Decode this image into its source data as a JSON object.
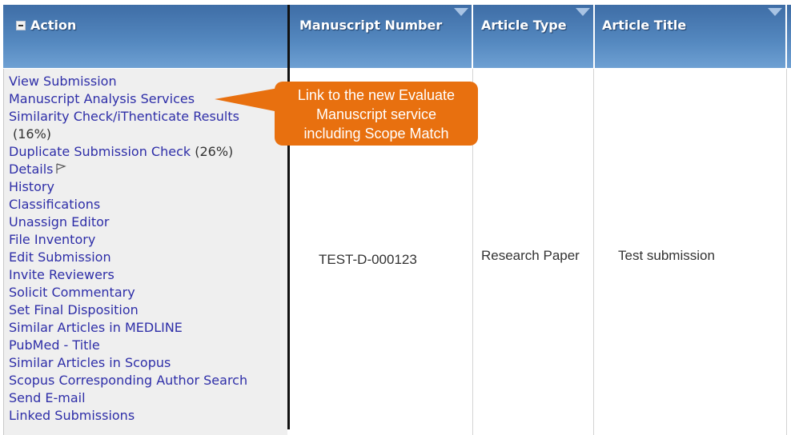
{
  "table": {
    "columns": [
      {
        "label": "Action",
        "collapse_icon": "minus-icon"
      },
      {
        "label": "Manuscript Number",
        "sort_icon": "sort-triangle-icon"
      },
      {
        "label": "Article Type",
        "sort_icon": "sort-triangle-icon"
      },
      {
        "label": "Article Title",
        "sort_icon": "sort-triangle-icon"
      }
    ],
    "row": {
      "actions": [
        {
          "label": "View Submission"
        },
        {
          "label": "Manuscript Analysis Services"
        },
        {
          "label": "Similarity Check/iThenticate Results",
          "suffix": "(16%)"
        },
        {
          "label": "Duplicate Submission Check",
          "suffix": "(26%)"
        },
        {
          "label": "Details",
          "icon": "flag-icon"
        },
        {
          "label": "History"
        },
        {
          "label": "Classifications"
        },
        {
          "label": "Unassign Editor"
        },
        {
          "label": "File Inventory"
        },
        {
          "label": "Edit Submission"
        },
        {
          "label": "Invite Reviewers"
        },
        {
          "label": "Solicit Commentary"
        },
        {
          "label": "Set Final Disposition"
        },
        {
          "label": "Similar Articles in MEDLINE"
        },
        {
          "label": "PubMed - Title"
        },
        {
          "label": "Similar Articles in Scopus"
        },
        {
          "label": "Scopus Corresponding Author Search"
        },
        {
          "label": "Send E-mail"
        },
        {
          "label": "Linked Submissions"
        }
      ],
      "manuscript_number": "TEST-D-000123",
      "article_type": "Research Paper",
      "article_title": "Test submission"
    }
  },
  "callout": {
    "lines": [
      "Link to the new Evaluate",
      "Manuscript service",
      "including Scope Match"
    ],
    "color": "#e8700f"
  },
  "colors": {
    "link": "#2e2ea8",
    "header_top": "#3e6da6",
    "header_bottom": "#6ea0d3"
  }
}
